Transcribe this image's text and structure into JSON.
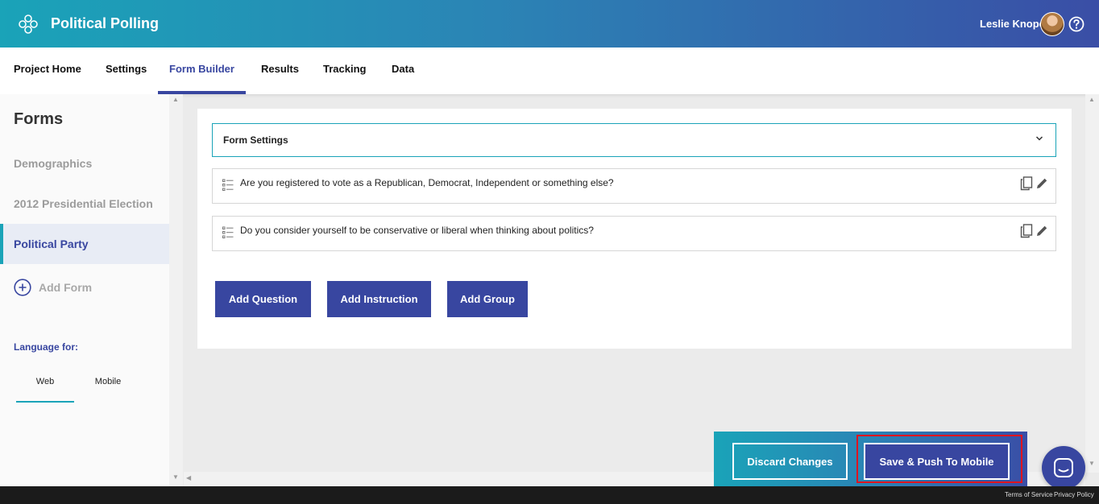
{
  "header": {
    "app_title": "Political Polling",
    "user_name": "Leslie Knope",
    "logo_icon": "clover-logo-icon",
    "help_icon": "question-circle-icon"
  },
  "nav": {
    "tabs": [
      {
        "label": "Project Home"
      },
      {
        "label": "Settings"
      },
      {
        "label": "Form Builder",
        "active": true
      },
      {
        "label": "Results"
      },
      {
        "label": "Tracking"
      },
      {
        "label": "Data"
      }
    ]
  },
  "sidebar": {
    "title": "Forms",
    "items": [
      {
        "label": "Demographics"
      },
      {
        "label": "2012 Presidential Election"
      },
      {
        "label": "Political Party",
        "active": true
      }
    ],
    "add_form_label": "Add Form",
    "language_label": "Language for:",
    "language_tabs": [
      {
        "label": "Web",
        "active": true
      },
      {
        "label": "Mobile"
      }
    ]
  },
  "main": {
    "form_settings_label": "Form Settings",
    "questions": [
      {
        "text": "Are you registered to vote as a Republican, Democrat, Independent or something else?"
      },
      {
        "text": "Do you consider yourself to be conservative or liberal when thinking about politics?"
      }
    ],
    "buttons": {
      "add_question": "Add Question",
      "add_instruction": "Add Instruction",
      "add_group": "Add Group"
    }
  },
  "actions": {
    "discard": "Discard Changes",
    "save_push": "Save & Push To Mobile"
  },
  "footer": {
    "terms": "Terms of Service",
    "privacy": "Privacy Policy"
  },
  "colors": {
    "accent": "#3846a0",
    "teal": "#1aa3b8",
    "highlight": "#e0141e"
  }
}
